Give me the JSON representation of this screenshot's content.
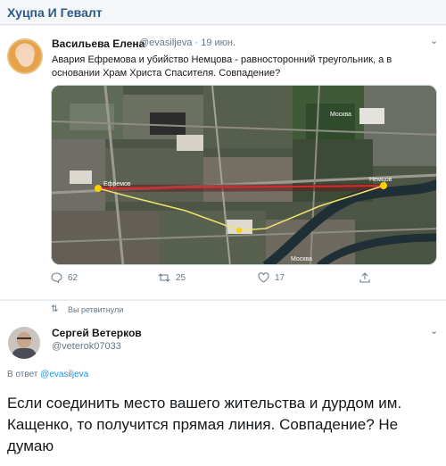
{
  "channel": {
    "title": "Хуцпа И Гевалт"
  },
  "tweet1": {
    "name": "Васильева Елена",
    "handle": "@evasiljeva",
    "date": "· 19 июн.",
    "text": "Авария Ефремова и убийство Немцова - равносторонний треугольник, а в основании Храм Христа Спасителя. Совпадение?",
    "map_labels": {
      "left_marker": "Ефремов",
      "right_marker": "Немцов",
      "top_right": "Москва",
      "bottom": "Москва"
    },
    "replies": "62",
    "retweets": "25",
    "likes": "17"
  },
  "retweeted": {
    "label": "Вы ретвитнули"
  },
  "tweet2": {
    "name": "Сергей Ветерков",
    "handle": "@veterok07033",
    "reply_prefix": "В ответ",
    "reply_handle": "@evasiljeva",
    "text": "Если соединить место вашего жительства и дурдом им. Кащенко, то получится прямая линия. Совпадение? Не думаю"
  },
  "colors": {
    "accent": "#1b95e0",
    "muted": "#657786",
    "channel": "#2b5a8a",
    "route_line": "#f0e26a",
    "straight_line": "#d92b2b",
    "marker": "#ffd000"
  },
  "icons": [
    "chevron-down-icon",
    "reply-icon",
    "retweet-icon",
    "like-icon",
    "share-icon"
  ]
}
